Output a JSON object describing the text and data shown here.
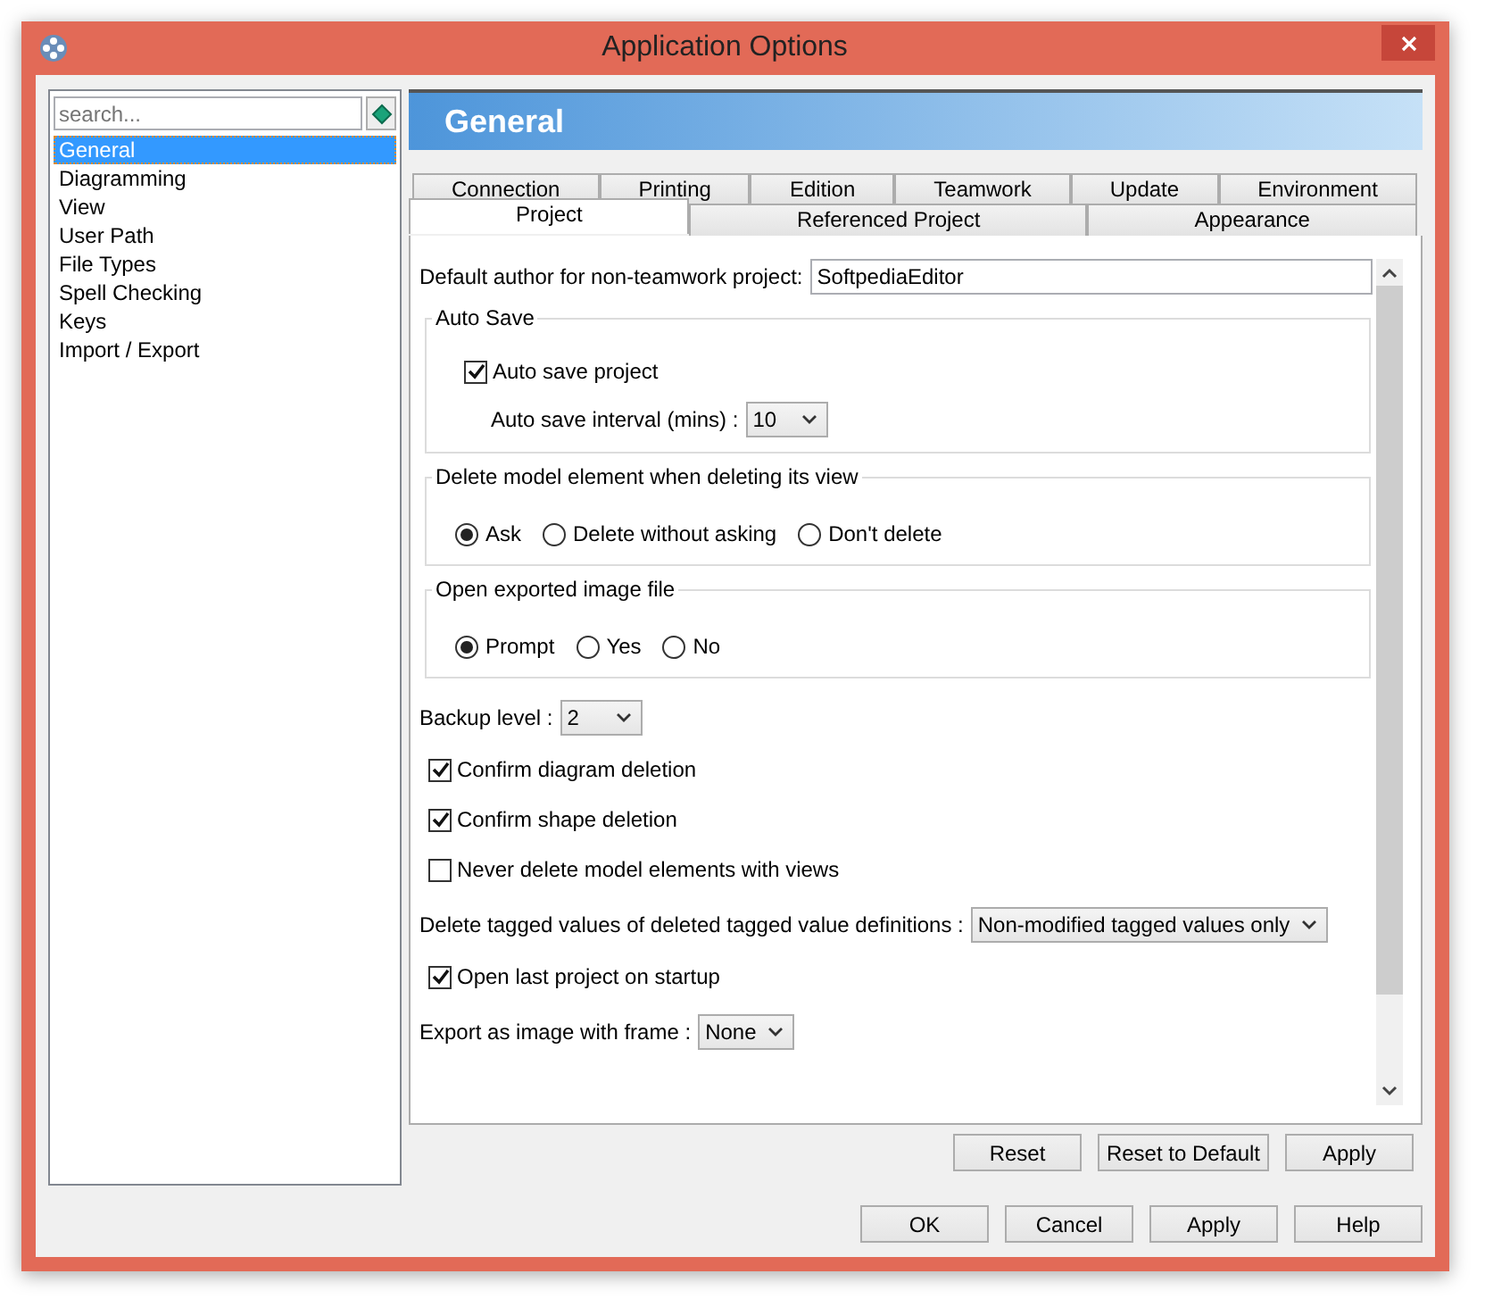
{
  "window": {
    "title": "Application Options"
  },
  "sidebar": {
    "search": {
      "placeholder": "search..."
    },
    "items": [
      {
        "label": "General",
        "selected": true
      },
      {
        "label": "Diagramming",
        "selected": false
      },
      {
        "label": "View",
        "selected": false
      },
      {
        "label": "User Path",
        "selected": false
      },
      {
        "label": "File Types",
        "selected": false
      },
      {
        "label": "Spell Checking",
        "selected": false
      },
      {
        "label": "Keys",
        "selected": false
      },
      {
        "label": "Import / Export",
        "selected": false
      }
    ]
  },
  "header": {
    "title": "General"
  },
  "tabs": [
    [
      {
        "label": "Connection",
        "selected": false
      },
      {
        "label": "Printing",
        "selected": false
      },
      {
        "label": "Edition",
        "selected": false
      },
      {
        "label": "Teamwork",
        "selected": false
      },
      {
        "label": "Update",
        "selected": false
      },
      {
        "label": "Environment",
        "selected": false
      }
    ],
    [
      {
        "label": "Project",
        "selected": true
      },
      {
        "label": "Referenced Project",
        "selected": false
      },
      {
        "label": "Appearance",
        "selected": false
      }
    ]
  ],
  "settings": [
    {
      "kind": "text",
      "label": "Default author for non-teamwork project:",
      "value": "SoftpediaEditor"
    },
    {
      "kind": "group",
      "title": "Auto Save",
      "children": [
        {
          "kind": "checkbox",
          "label": "Auto save project",
          "checked": true
        },
        {
          "kind": "dropdown",
          "label": "Auto save interval (mins) :",
          "value": "10"
        }
      ]
    },
    {
      "kind": "group",
      "title": "Delete model element when deleting its view",
      "children": [
        {
          "kind": "radios",
          "options": [
            {
              "label": "Ask",
              "selected": true
            },
            {
              "label": "Delete without asking",
              "selected": false
            },
            {
              "label": "Don't delete",
              "selected": false
            }
          ]
        }
      ]
    },
    {
      "kind": "group",
      "title": "Open exported image file",
      "children": [
        {
          "kind": "radios",
          "options": [
            {
              "label": "Prompt",
              "selected": true
            },
            {
              "label": "Yes",
              "selected": false
            },
            {
              "label": "No",
              "selected": false
            }
          ]
        }
      ]
    },
    {
      "kind": "dropdown",
      "label": "Backup level :",
      "value": "2"
    },
    {
      "kind": "checkbox",
      "label": "Confirm diagram deletion",
      "checked": true
    },
    {
      "kind": "checkbox",
      "label": "Confirm shape deletion",
      "checked": true
    },
    {
      "kind": "checkbox",
      "label": "Never delete model elements with views",
      "checked": false
    },
    {
      "kind": "dropdown",
      "label": "Delete tagged values of deleted tagged value definitions :",
      "value": "Non-modified tagged values only"
    },
    {
      "kind": "checkbox",
      "label": "Open last project on startup",
      "checked": true
    },
    {
      "kind": "dropdown",
      "label": "Export as image with frame :",
      "value": "None"
    }
  ],
  "panel_buttons": [
    "Reset",
    "Reset to Default",
    "Apply"
  ],
  "dialog_buttons": [
    "OK",
    "Cancel",
    "Apply",
    "Help"
  ]
}
